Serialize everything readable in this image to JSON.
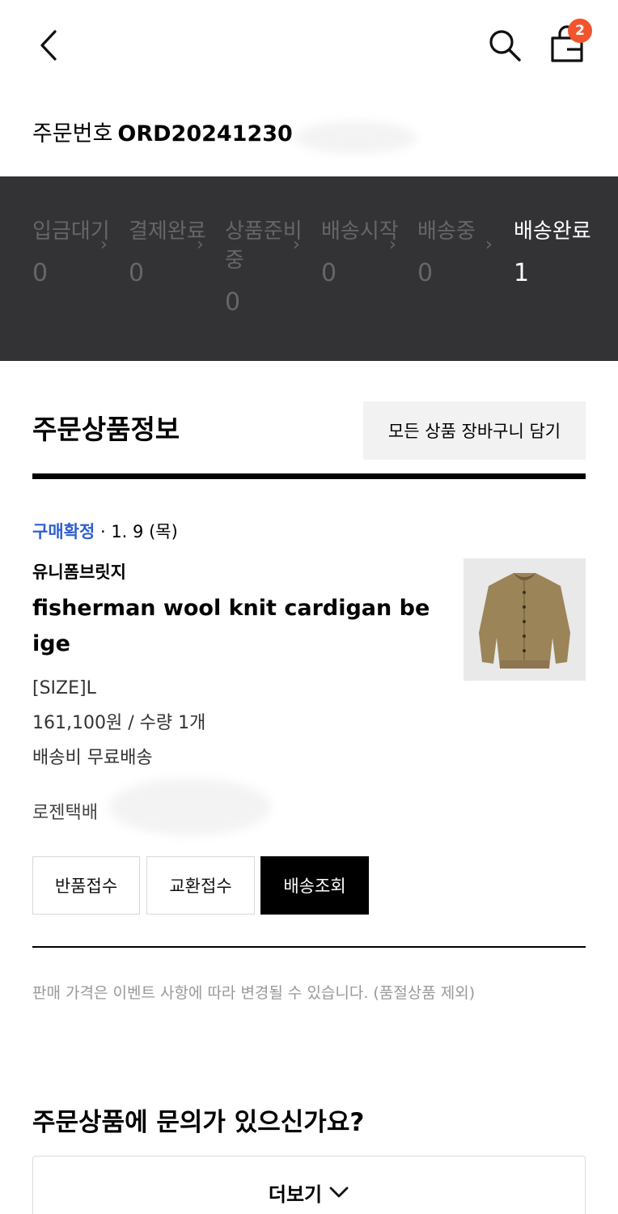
{
  "header": {
    "cart_badge": "2"
  },
  "order": {
    "label": "주문번호",
    "number": "ORD20241230"
  },
  "status_steps": [
    {
      "label": "입금대기",
      "count": "0",
      "active": false
    },
    {
      "label": "결제완료",
      "count": "0",
      "active": false
    },
    {
      "label": "상품준비중",
      "count": "0",
      "active": false
    },
    {
      "label": "배송시작",
      "count": "0",
      "active": false
    },
    {
      "label": "배송중",
      "count": "0",
      "active": false
    },
    {
      "label": "배송완료",
      "count": "1",
      "active": true
    }
  ],
  "section": {
    "title": "주문상품정보",
    "cart_all_button": "모든 상품 장바구니 담기"
  },
  "product": {
    "status": "구매확정",
    "date": "· 1. 9 (목)",
    "brand": "유니폼브릿지",
    "name": "fisherman wool knit cardigan beige",
    "size": "[SIZE]L",
    "price_qty": "161,100원 / 수량 1개",
    "shipping": "배송비 무료배송",
    "courier": "로젠택배",
    "image_color": "#9c8459"
  },
  "actions": {
    "return": "반품접수",
    "exchange": "교환접수",
    "track": "배송조회"
  },
  "notice": "판매 가격은 이벤트 사항에 따라 변경될 수 있습니다. (품절상품 제외)",
  "inquiry": {
    "title": "주문상품에 문의가 있으신가요?",
    "more_button": "더보기"
  },
  "colors": {
    "accent_badge": "#f2542d",
    "status_blue": "#2f5fd0",
    "status_bar_bg": "#333335"
  }
}
